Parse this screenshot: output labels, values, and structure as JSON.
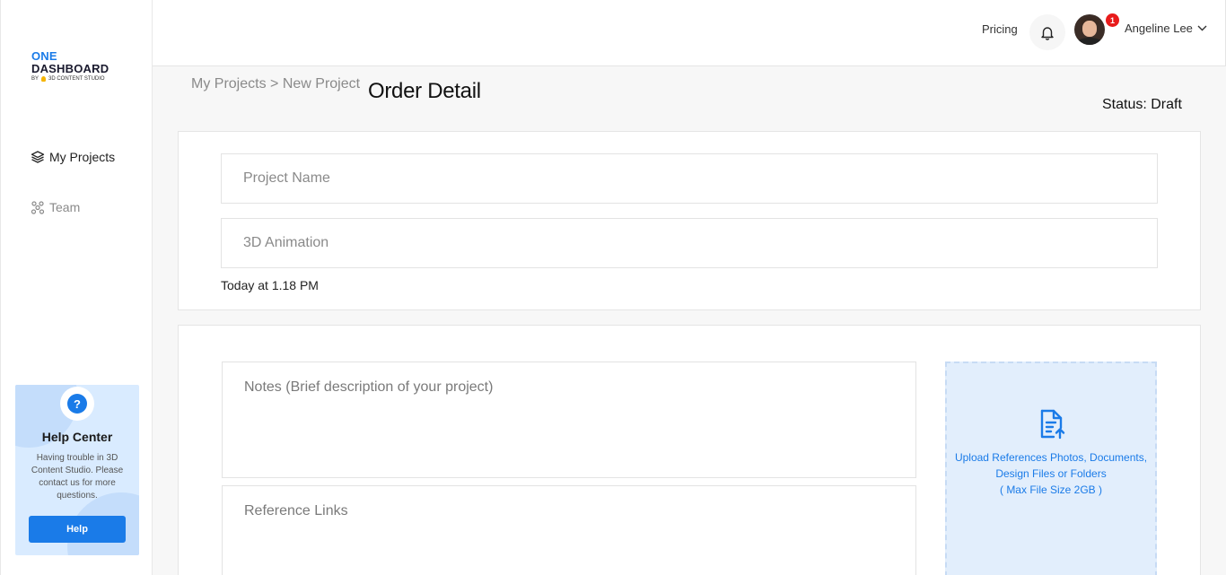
{
  "logo": {
    "line1": "ONE",
    "line2": "DASHBOARD",
    "by": "BY",
    "studio": "3D CONTENT STUDIO"
  },
  "sidebar": {
    "items": [
      {
        "label": "My Projects",
        "icon": "layers-icon",
        "active": true
      },
      {
        "label": "Team",
        "icon": "team-icon",
        "active": false
      }
    ]
  },
  "help": {
    "title": "Help Center",
    "text": "Having trouble in 3D Content Studio. Please contact us for more questions.",
    "button": "Help"
  },
  "header": {
    "pricing": "Pricing",
    "notification_count": "1",
    "user_name": "Angeline Lee"
  },
  "breadcrumb": {
    "parent": "My Projects",
    "separator": ">",
    "current": "New Project"
  },
  "page": {
    "title": "Order Detail",
    "status": "Status: Draft"
  },
  "form": {
    "project_name_placeholder": "Project Name",
    "project_type_placeholder": "3D Animation",
    "date": "Today at 1.18 PM",
    "notes_placeholder": "Notes (Brief description of your project)",
    "links_placeholder": "Reference Links"
  },
  "upload": {
    "line1": "Upload References Photos, Documents,",
    "line2": "Design Files or Folders",
    "line3": "( Max File Size 2GB )"
  },
  "colors": {
    "accent": "#1a7be8",
    "badge": "#e81b1b",
    "upload_bg": "#e2eefc"
  }
}
